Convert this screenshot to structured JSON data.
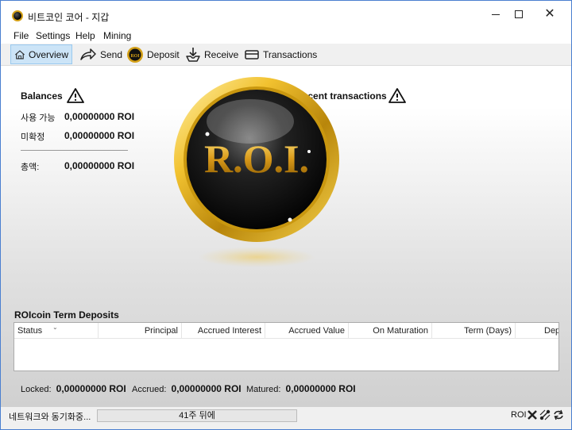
{
  "window": {
    "title": "비트코인 코어 - 지갑",
    "controls": {
      "minimize": "minimize",
      "maximize": "maximize",
      "close": "✕"
    }
  },
  "menu": [
    "File",
    "Settings",
    "Help",
    "Mining"
  ],
  "toolbar": {
    "overview": "Overview",
    "send": "Send",
    "deposit": "Deposit",
    "receive": "Receive",
    "transactions": "Transactions",
    "active": "Overview"
  },
  "balances": {
    "title": "Balances",
    "available_label": "사용 가능",
    "available_value": "0,00000000 ROI",
    "pending_label": "미확정",
    "pending_value": "0,00000000 ROI",
    "total_label": "총액:",
    "total_value": "0,00000000 ROI"
  },
  "recent": {
    "title": "Recent transactions"
  },
  "logo": {
    "text": "R.O.I."
  },
  "deposits": {
    "title": "ROIcoin Term Deposits",
    "columns": [
      "Status",
      "Principal",
      "Accrued Interest",
      "Accrued Value",
      "On Maturation",
      "Term (Days)",
      "Dep"
    ],
    "rows": []
  },
  "totals": {
    "locked_label": "Locked:",
    "locked_value": "0,00000000 ROI",
    "accrued_label": "Accrued:",
    "accrued_value": "0,00000000 ROI",
    "matured_label": "Matured:",
    "matured_value": "0,00000000 ROI"
  },
  "status": {
    "sync_text": "네트워크와 동기화중...",
    "progress_text": "41주 뒤에",
    "progress_fraction": 0.0,
    "unit": "ROI",
    "icons": [
      "network-disconnected-icon",
      "connections-icon",
      "sync-icon"
    ]
  },
  "colors": {
    "accent": "#cce4f7",
    "gold": "#d4a017",
    "titlebar_border": "#4a7fd0"
  }
}
